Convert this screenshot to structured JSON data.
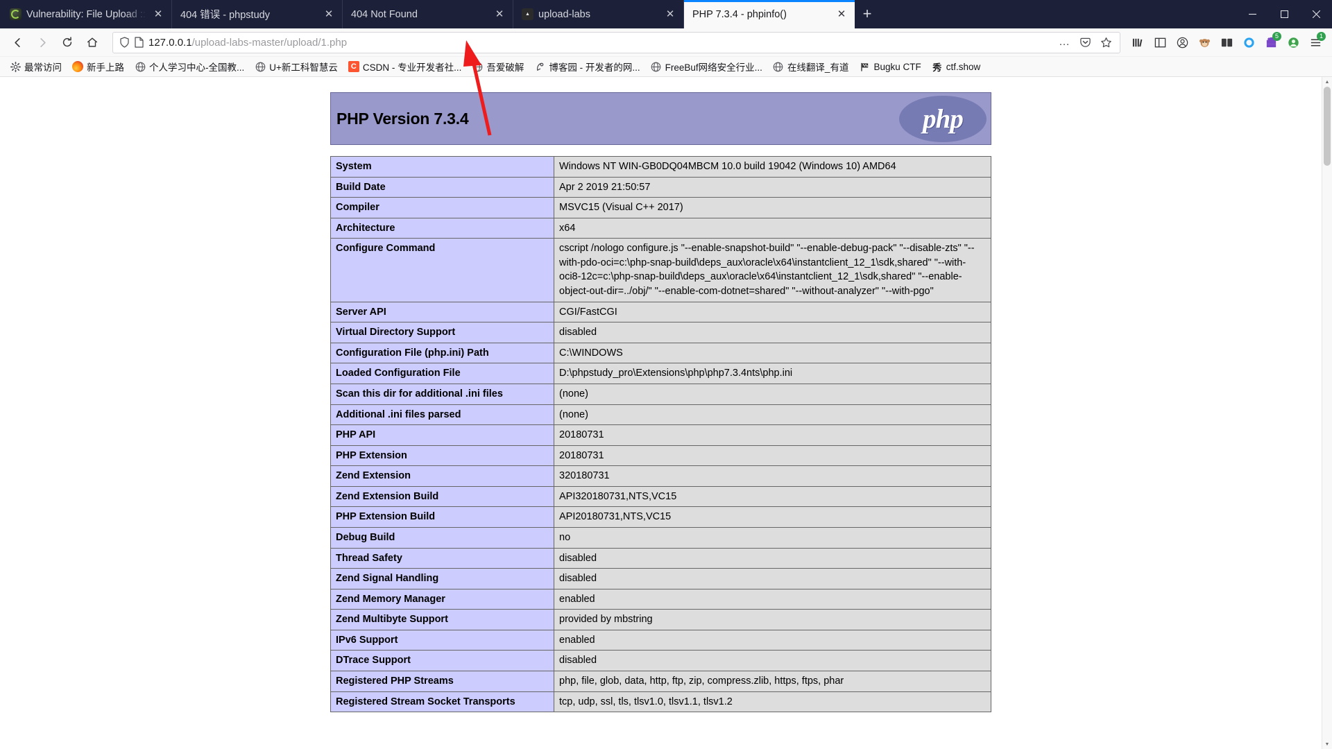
{
  "window": {
    "minimize_label": "—",
    "maximize_label": "❐",
    "close_label": "✕",
    "newtab_label": "+"
  },
  "tabs": [
    {
      "title": "Vulnerability: File Upload :: D",
      "favicon": "dvwa-icon",
      "close_label": "✕",
      "active": false
    },
    {
      "title": "404 错误 - phpstudy",
      "favicon": "generic-icon",
      "close_label": "✕",
      "active": false
    },
    {
      "title": "404 Not Found",
      "favicon": "generic-icon",
      "close_label": "✕",
      "active": false
    },
    {
      "title": "upload-labs",
      "favicon": "upload-icon",
      "close_label": "✕",
      "active": false
    },
    {
      "title": "PHP 7.3.4 - phpinfo()",
      "favicon": "none",
      "close_label": "✕",
      "active": true
    }
  ],
  "nav": {
    "back_label": "←",
    "forward_label": "→",
    "reload_label": "⟳",
    "home_label": "⌂"
  },
  "urlbar": {
    "host": "127.0.0.1",
    "path": "/upload-labs-master/upload/1.php",
    "full_url": "127.0.0.1/upload-labs-master/upload/1.php",
    "shield_icon": "shield-icon",
    "page_icon": "page-icon",
    "more_label": "…",
    "pocket_label": "pocket-icon",
    "bookmark_label": "☆"
  },
  "toolbar_right": {
    "library_icon": "library-icon",
    "sidebar_icon": "sidebar-icon",
    "account_icon": "account-icon",
    "monkey_icon": "monkey-icon",
    "containers_icon": "containers-icon",
    "circle_icon": "circle-icon",
    "puzzle_icon": "puzzle-icon",
    "puzzle_badge": "5",
    "avatar_icon": "avatar-icon",
    "menu_icon": "menu-icon",
    "menu_badge": "1"
  },
  "bookmarks": [
    {
      "label": "最常访问",
      "icon": "gear-icon"
    },
    {
      "label": "新手上路",
      "icon": "firefox-icon"
    },
    {
      "label": "个人学习中心-全国教...",
      "icon": "globe-icon"
    },
    {
      "label": "U+新工科智慧云",
      "icon": "globe-icon"
    },
    {
      "label": "CSDN - 专业开发者社...",
      "icon": "csdn-icon"
    },
    {
      "label": "吾爱破解",
      "icon": "globe-icon"
    },
    {
      "label": "博客园 - 开发者的网...",
      "icon": "cnblogs-icon"
    },
    {
      "label": "FreeBuf网络安全行业...",
      "icon": "globe-icon"
    },
    {
      "label": "在线翻译_有道",
      "icon": "globe-icon"
    },
    {
      "label": "Bugku CTF",
      "icon": "flag-icon"
    },
    {
      "label": "ctf.show",
      "icon": "ctfshow-icon"
    }
  ],
  "phpinfo": {
    "version_title": "PHP Version 7.3.4",
    "logo_text": "php",
    "header_bg": "#9999cc",
    "key_bg": "#ccccff",
    "value_bg": "#dddddd",
    "rows": [
      {
        "key": "System",
        "value": "Windows NT WIN-GB0DQ04MBCM 10.0 build 19042 (Windows 10) AMD64"
      },
      {
        "key": "Build Date",
        "value": "Apr 2 2019 21:50:57"
      },
      {
        "key": "Compiler",
        "value": "MSVC15 (Visual C++ 2017)"
      },
      {
        "key": "Architecture",
        "value": "x64"
      },
      {
        "key": "Configure Command",
        "value": "cscript /nologo configure.js \"--enable-snapshot-build\" \"--enable-debug-pack\" \"--disable-zts\" \"--with-pdo-oci=c:\\php-snap-build\\deps_aux\\oracle\\x64\\instantclient_12_1\\sdk,shared\" \"--with-oci8-12c=c:\\php-snap-build\\deps_aux\\oracle\\x64\\instantclient_12_1\\sdk,shared\" \"--enable-object-out-dir=../obj/\" \"--enable-com-dotnet=shared\" \"--without-analyzer\" \"--with-pgo\""
      },
      {
        "key": "Server API",
        "value": "CGI/FastCGI"
      },
      {
        "key": "Virtual Directory Support",
        "value": "disabled"
      },
      {
        "key": "Configuration File (php.ini) Path",
        "value": "C:\\WINDOWS"
      },
      {
        "key": "Loaded Configuration File",
        "value": "D:\\phpstudy_pro\\Extensions\\php\\php7.3.4nts\\php.ini"
      },
      {
        "key": "Scan this dir for additional .ini files",
        "value": "(none)"
      },
      {
        "key": "Additional .ini files parsed",
        "value": "(none)"
      },
      {
        "key": "PHP API",
        "value": "20180731"
      },
      {
        "key": "PHP Extension",
        "value": "20180731"
      },
      {
        "key": "Zend Extension",
        "value": "320180731"
      },
      {
        "key": "Zend Extension Build",
        "value": "API320180731,NTS,VC15"
      },
      {
        "key": "PHP Extension Build",
        "value": "API20180731,NTS,VC15"
      },
      {
        "key": "Debug Build",
        "value": "no"
      },
      {
        "key": "Thread Safety",
        "value": "disabled"
      },
      {
        "key": "Zend Signal Handling",
        "value": "disabled"
      },
      {
        "key": "Zend Memory Manager",
        "value": "enabled"
      },
      {
        "key": "Zend Multibyte Support",
        "value": "provided by mbstring"
      },
      {
        "key": "IPv6 Support",
        "value": "enabled"
      },
      {
        "key": "DTrace Support",
        "value": "disabled"
      },
      {
        "key": "Registered PHP Streams",
        "value": "php, file, glob, data, http, ftp, zip, compress.zlib, https, ftps, phar"
      },
      {
        "key": "Registered Stream Socket Transports",
        "value": "tcp, udp, ssl, tls, tlsv1.0, tlsv1.1, tlsv1.2"
      }
    ]
  },
  "annotation": {
    "arrow_color": "#ee1c1c",
    "arrow_description": "red-arrow-pointing-at-url"
  },
  "scrollbar": {
    "up_label": "▲",
    "down_label": "▼"
  }
}
